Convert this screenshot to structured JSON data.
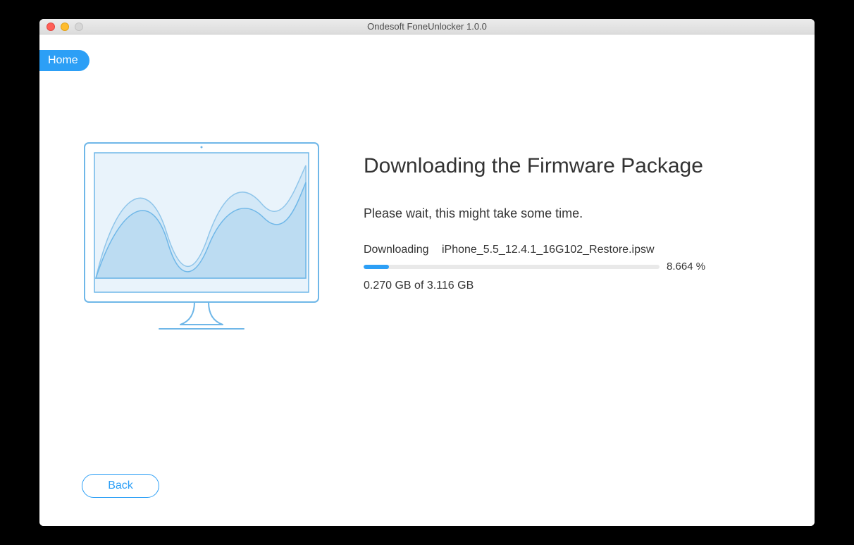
{
  "titlebar": {
    "title": "Ondesoft FoneUnlocker 1.0.0"
  },
  "nav": {
    "home_label": "Home"
  },
  "main": {
    "heading": "Downloading the Firmware Package",
    "subheading": "Please wait, this might take some time.",
    "downloading_label": "Downloading",
    "file_name": "iPhone_5.5_12.4.1_16G102_Restore.ipsw",
    "progress_percent": "8.664 %",
    "progress_value": 8.664,
    "size_text": "0.270 GB of 3.116 GB"
  },
  "footer": {
    "back_label": "Back"
  },
  "colors": {
    "accent": "#2c9ff6"
  }
}
